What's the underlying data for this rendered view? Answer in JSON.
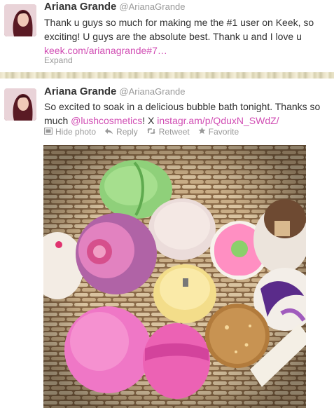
{
  "tweets": [
    {
      "name": "Ariana Grande",
      "username": "@ArianaGrande",
      "text": "Thank u guys so much for making me the #1 user on Keek, so exciting! U guys are the absolute best. Thank u and I love u",
      "link": "keek.com/arianagrande#7…",
      "expand_label": "Expand"
    },
    {
      "name": "Ariana Grande",
      "username": "@ArianaGrande",
      "text_before": "So excited to soak in a delicious bubble bath tonight. Thanks so much ",
      "mention": "@lushcosmetics",
      "text_middle": "! X ",
      "link": "instagr.am/p/QduxN_SWdZ/",
      "actions": {
        "hide_photo": "Hide photo",
        "reply": "Reply",
        "retweet": "Retweet",
        "favorite": "Favorite"
      }
    }
  ],
  "colors": {
    "link": "#d14eb4",
    "muted": "#999999",
    "text": "#333333"
  },
  "icons": {
    "hide_photo": "photo-icon",
    "reply": "reply-arrow-icon",
    "retweet": "retweet-icon",
    "favorite": "star-icon"
  }
}
